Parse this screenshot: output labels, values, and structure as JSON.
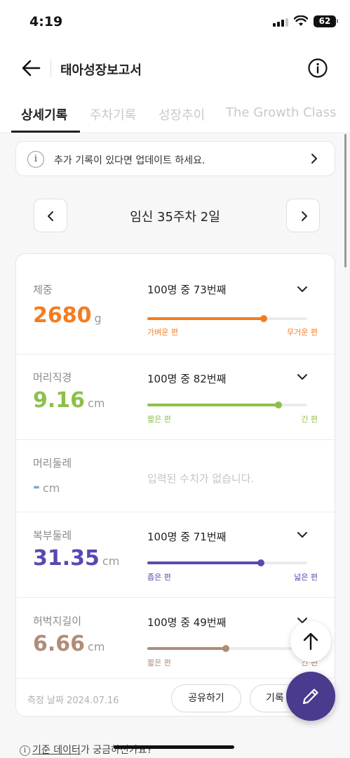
{
  "status_bar": {
    "time": "4:19",
    "battery": "62"
  },
  "header": {
    "title": "태아성장보고서"
  },
  "tabs": [
    {
      "label": "상세기록",
      "active": true
    },
    {
      "label": "주차기록",
      "active": false
    },
    {
      "label": "성장추이",
      "active": false
    },
    {
      "label": "The Growth Class",
      "active": false
    }
  ],
  "notice": {
    "icon": "i",
    "text": "추가 기록이 있다면 업데이트 하세요."
  },
  "week_nav": {
    "label": "임신 35주차 2일"
  },
  "metrics": [
    {
      "name": "체중",
      "value": "2680",
      "unit": "g",
      "rank": "100명 중 73번째",
      "percentile": 73,
      "low": "가벼운 편",
      "high": "무거운 편",
      "color": "#f47c20"
    },
    {
      "name": "머리직경",
      "value": "9.16",
      "unit": "cm",
      "rank": "100명 중 82번째",
      "percentile": 82,
      "low": "짧은 편",
      "high": "긴 편",
      "color": "#8dc04a"
    },
    {
      "name": "머리둘레",
      "value": "-",
      "unit": "cm",
      "empty_text": "입력된 수치가 없습니다.",
      "color": "#7aa6c9"
    },
    {
      "name": "복부둘레",
      "value": "31.35",
      "unit": "cm",
      "rank": "100명 중 71번째",
      "percentile": 71,
      "low": "좁은 편",
      "high": "넓은 편",
      "color": "#5a48b0"
    },
    {
      "name": "허벅지길이",
      "value": "6.66",
      "unit": "cm",
      "rank": "100명 중 49번째",
      "percentile": 49,
      "low": "짧은 편",
      "high": "긴 편",
      "color": "#b08d77"
    }
  ],
  "footer": {
    "measure_date": "측정 날짜 2024.07.16",
    "share_label": "공유하기",
    "record_label": "기록 편집"
  },
  "bottom_link": {
    "icon": "i",
    "link_text": "기준 데이터",
    "rest_text": "가 궁금하신가요?"
  },
  "colors": {
    "fab": "#4b3a8e"
  }
}
